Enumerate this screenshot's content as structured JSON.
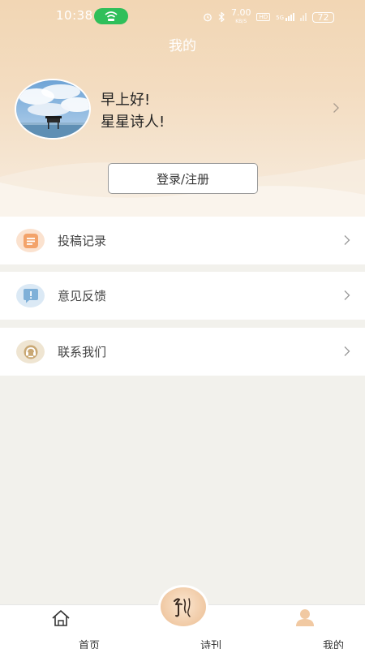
{
  "status_bar": {
    "time": "10:38",
    "network_speed": "7.00",
    "network_unit": "KB/S",
    "hd": "HD",
    "signal": "5G",
    "battery": "72"
  },
  "page_title": "我的",
  "profile": {
    "greeting_line1": "早上好!",
    "greeting_line2": "星星诗人!"
  },
  "login_button": "登录/注册",
  "menu": [
    {
      "label": "投稿记录",
      "icon": "document-icon",
      "color": "#f3a36a"
    },
    {
      "label": "意见反馈",
      "icon": "feedback-icon",
      "color": "#7fb0d8"
    },
    {
      "label": "联系我们",
      "icon": "contact-icon",
      "color": "#c9a874"
    }
  ],
  "tabbar": {
    "items": [
      {
        "label": "首页",
        "icon": "home-icon"
      },
      {
        "label": "诗刊",
        "icon": "calligraphy-logo-icon"
      },
      {
        "label": "我的",
        "icon": "person-icon",
        "active": true
      }
    ]
  },
  "colors": {
    "accent": "#f2d6b4",
    "background": "#f2f1ec",
    "wifi": "#2fbf5a"
  }
}
